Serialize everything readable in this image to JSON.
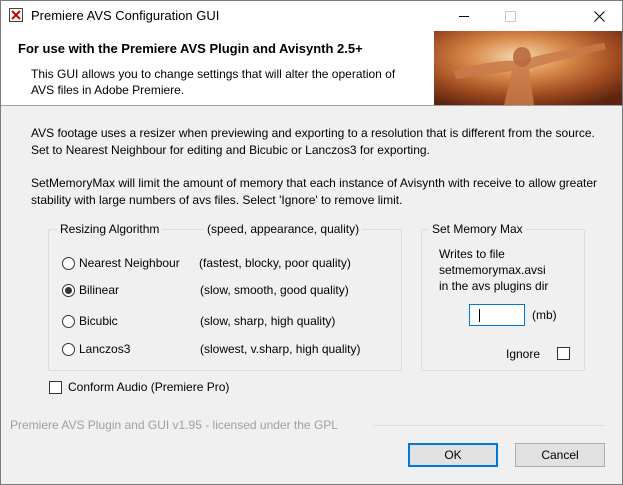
{
  "window": {
    "title": "Premiere AVS Configuration GUI"
  },
  "header": {
    "title": "For use with the Premiere AVS Plugin and Avisynth 2.5+",
    "description": "This GUI allows you to change settings that will alter the operation of AVS files in Adobe Premiere."
  },
  "info": {
    "resizer": "AVS footage uses a resizer when previewing and exporting to a resolution that is different from the source. Set to Nearest Neighbour for editing and Bicubic or Lanczos3 for exporting.",
    "memory": "SetMemoryMax will limit the amount of memory that each instance of Avisynth with receive to allow greater stability with large numbers of avs files. Select 'Ignore' to remove limit."
  },
  "resizing": {
    "legend": "Resizing Algorithm",
    "legend_hint": "(speed, appearance, quality)",
    "options": [
      {
        "label": "Nearest Neighbour",
        "desc": "(fastest, blocky, poor quality)",
        "selected": false
      },
      {
        "label": "Bilinear",
        "desc": "(slow, smooth, good quality)",
        "selected": true
      },
      {
        "label": "Bicubic",
        "desc": "(slow, sharp, high quality)",
        "selected": false
      },
      {
        "label": "Lanczos3",
        "desc": "(slowest, v.sharp, high quality)",
        "selected": false
      }
    ]
  },
  "memory": {
    "legend": "Set Memory Max",
    "text_line1": "Writes to file",
    "text_line2": "setmemorymax.avsi",
    "text_line3": "in the avs plugins dir",
    "value": "",
    "unit": "(mb)",
    "ignore_label": "Ignore",
    "ignore_checked": false
  },
  "conform_audio": {
    "label": "Conform Audio (Premiere Pro)",
    "checked": false
  },
  "footer": {
    "text": "Premiere AVS Plugin and GUI v1.95 - licensed under the GPL"
  },
  "buttons": {
    "ok": "OK",
    "cancel": "Cancel"
  }
}
